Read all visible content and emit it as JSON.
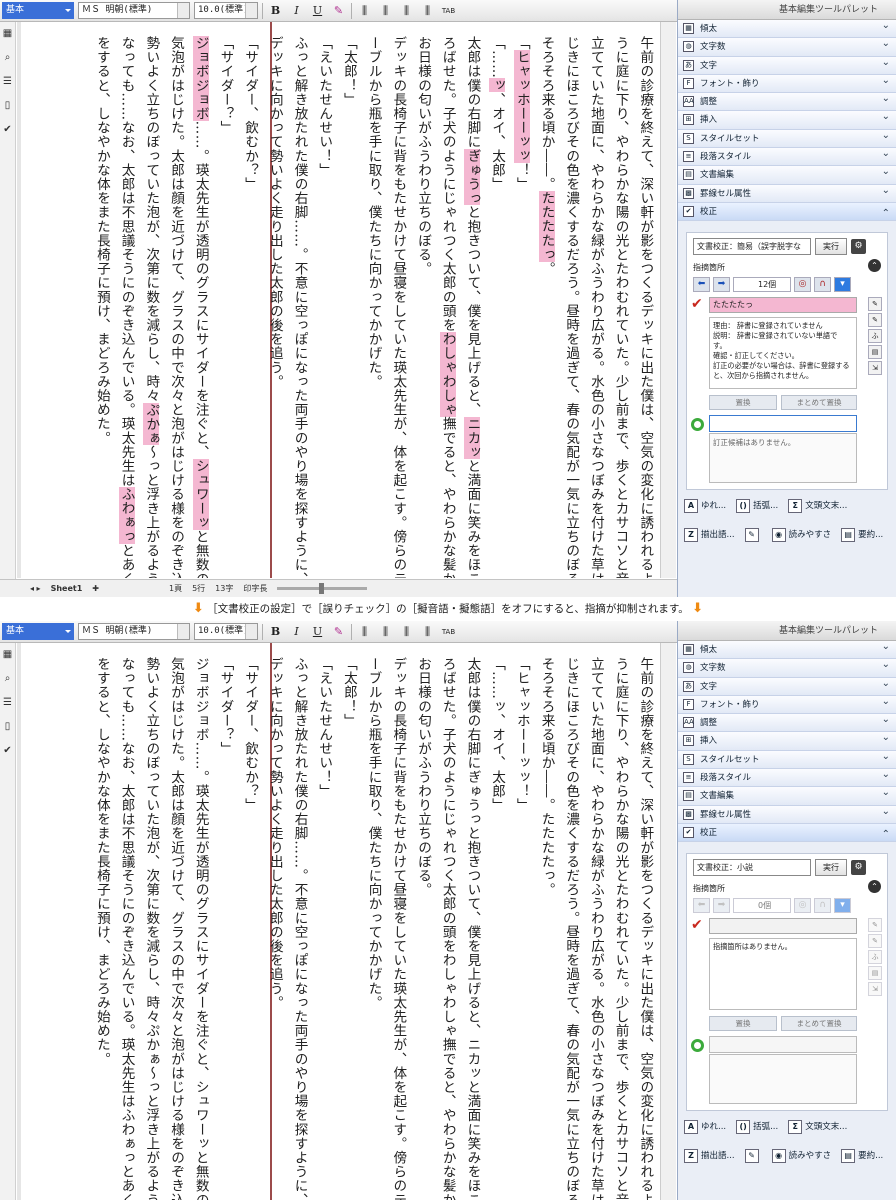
{
  "caption": {
    "text": "［文書校正の設定］で［誤りチェック］の［擬音語・擬態語］をオフにすると、指摘が抑制されます。",
    "arrow": "⬇"
  },
  "toolbar": {
    "style_name": "基本",
    "font": "ＭＳ 明朝(標準)",
    "size": "10.0(標準)",
    "bold": "B",
    "italic": "I",
    "underline": "U",
    "tab": "TAB"
  },
  "columns": [
    {
      "segments": [
        {
          "t": "午前の診療を終えて、深い軒が影をつくるデッキに出た僕は、空気の変化に誘われるよ",
          "h": false
        }
      ]
    },
    {
      "segments": [
        {
          "t": "うに庭に下り、やわらかな陽の光とたわむれていた。少し前まで、歩くとカサコソと音を",
          "h": false
        }
      ]
    },
    {
      "segments": [
        {
          "t": "立てていた地面に、やわらかな緑がふうわり広がる。水色の小さなつぼみを付けた草は、",
          "h": false
        }
      ]
    },
    {
      "segments": [
        {
          "t": "じきにほころびその色を濃くするだろう。昼時を過ぎて、春の気配が一気に立ちのぼる。",
          "h": false
        }
      ]
    },
    {
      "segments": [
        {
          "t": "そろそろ来る頃か――。",
          "h": false
        },
        {
          "t": "たたたたっ",
          "h": true
        },
        {
          "t": "。",
          "h": false
        }
      ]
    },
    {
      "segments": [
        {
          "t": "「",
          "h": false
        },
        {
          "t": "ヒャッホーーッッ",
          "h": true
        },
        {
          "t": "！」",
          "h": false
        }
      ]
    },
    {
      "segments": [
        {
          "t": "「……",
          "h": false
        },
        {
          "t": "ッ",
          "h": true
        },
        {
          "t": "、オイ、太郎」",
          "h": false
        }
      ]
    },
    {
      "segments": [
        {
          "t": "太郎は僕の右脚に",
          "h": false
        },
        {
          "t": "ぎゅうっ",
          "h": true
        },
        {
          "t": "と抱きついて、僕を見上げると、",
          "h": false
        },
        {
          "t": "ニカッ",
          "h": true
        },
        {
          "t": "と満面に笑みをほこ",
          "h": false
        }
      ]
    },
    {
      "segments": [
        {
          "t": "ろばせた。子犬のようにじゃれつく太郎の頭を",
          "h": false
        },
        {
          "t": "わしゃわしゃ",
          "h": true
        },
        {
          "t": "撫でると、やわらかな髪から",
          "h": false
        }
      ]
    },
    {
      "segments": [
        {
          "t": "お日様の匂いがふうわり立ちのぼる。",
          "h": false
        }
      ]
    },
    {
      "segments": [
        {
          "t": "デッキの長椅子に背をもたせかけて昼寝をしていた瑛太先生が、体を起こす。傍らのテ",
          "h": false
        }
      ]
    },
    {
      "segments": [
        {
          "t": "ーブルから瓶を手に取り、僕たちに向かってかかげた。",
          "h": false
        }
      ]
    },
    {
      "segments": [
        {
          "t": "「太郎！」",
          "h": false
        }
      ]
    },
    {
      "segments": [
        {
          "t": "「えいたせんせい！」",
          "h": false
        }
      ]
    },
    {
      "segments": [
        {
          "t": "ふっと解き放たれた僕の右脚……。不意に空っぽになった両手のやり場を探すように、",
          "h": false
        }
      ]
    },
    {
      "segments": [
        {
          "t": "デッキに向かって勢いよく走り出した太郎の後を追う。",
          "h": false
        }
      ]
    },
    {
      "segments": [
        {
          "t": "「サイダー、飲むか？」",
          "h": false
        }
      ]
    },
    {
      "segments": [
        {
          "t": "「サイダー？」",
          "h": false
        }
      ]
    },
    {
      "segments": [
        {
          "t": "ジョボジョボ",
          "h": true
        },
        {
          "t": "……。瑛太先生が透明のグラスにサイダーを注ぐと、",
          "h": false
        },
        {
          "t": "シュワーッ",
          "h": true
        },
        {
          "t": "と無数の",
          "h": false
        }
      ]
    },
    {
      "segments": [
        {
          "t": "気泡がはじけた。太郎は顔を近づけて、グラスの中で次々と泡がはじける様をのぞき込む。",
          "h": false
        }
      ]
    },
    {
      "segments": [
        {
          "t": "勢いよく立ちのぼっていた泡が、次第に数を減らし、時々",
          "h": false
        },
        {
          "t": "ぷかぁ",
          "h": true
        },
        {
          "t": "～っと浮き上がるように",
          "h": false
        }
      ]
    },
    {
      "segments": [
        {
          "t": "なっても……なお、太郎は不思議そうにのぞき込んでいる。瑛太先生は",
          "h": false
        },
        {
          "t": "ふわぁっ",
          "h": true
        },
        {
          "t": "とあくび",
          "h": false
        }
      ]
    },
    {
      "segments": [
        {
          "t": "をすると、しなやかな体をまた長椅子に預け、まどろみ始めた。",
          "h": false
        }
      ]
    }
  ],
  "statusbar": {
    "sheet": "Sheet1",
    "page": "1頁",
    "line": "5行",
    "chars": "13字",
    "mode": "印字長"
  },
  "palette": {
    "title": "基本編集ツールパレット",
    "items": [
      "傾太",
      "文字数",
      "文字",
      "フォント・飾り",
      "調整",
      "挿入",
      "スタイルセット",
      "段落スタイル",
      "文書編集",
      "罫線セル属性",
      "校正"
    ],
    "icons": [
      "▦",
      "◍",
      "あ",
      "F",
      "AA",
      "⊞",
      "S",
      "≡",
      "▤",
      "▩",
      "✔"
    ],
    "execute": "実行",
    "shiteki_label": "指摘箇所",
    "replace": "置換",
    "replace_all": "まとめて置換",
    "tools": [
      {
        "icon": "A",
        "label": "ゆれ..."
      },
      {
        "icon": "()",
        "label": "括弧..."
      },
      {
        "icon": "Σ",
        "label": "文頭文末..."
      },
      {
        "icon": "Z",
        "label": "揃出語..."
      },
      {
        "icon": "✎",
        "label": ""
      },
      {
        "icon": "◉",
        "label": "読みやすさ"
      },
      {
        "icon": "▤",
        "label": "要約..."
      }
    ]
  },
  "panelA": {
    "mode": "文書校正：簡易（誤字脱字な",
    "count": "12個",
    "error_word": "たたたたっ",
    "reason_lines": [
      "理由： 辞書に登録されていません",
      "説明： 辞書に登録されていない単語で",
      "す。",
      "確認・訂正してください。",
      "訂正の必要がない場合は、辞書に登録する",
      "と、次回から指摘されません。"
    ],
    "suggestion": "訂正候補はありません。"
  },
  "panelB": {
    "mode": "文書校正：小説",
    "count": "0個",
    "no_error": "指摘箇所はありません。"
  },
  "colors": {
    "highlight": "#f4b7d1",
    "accent": "#3a6fd8",
    "caption_arrow": "#ef8a12"
  }
}
